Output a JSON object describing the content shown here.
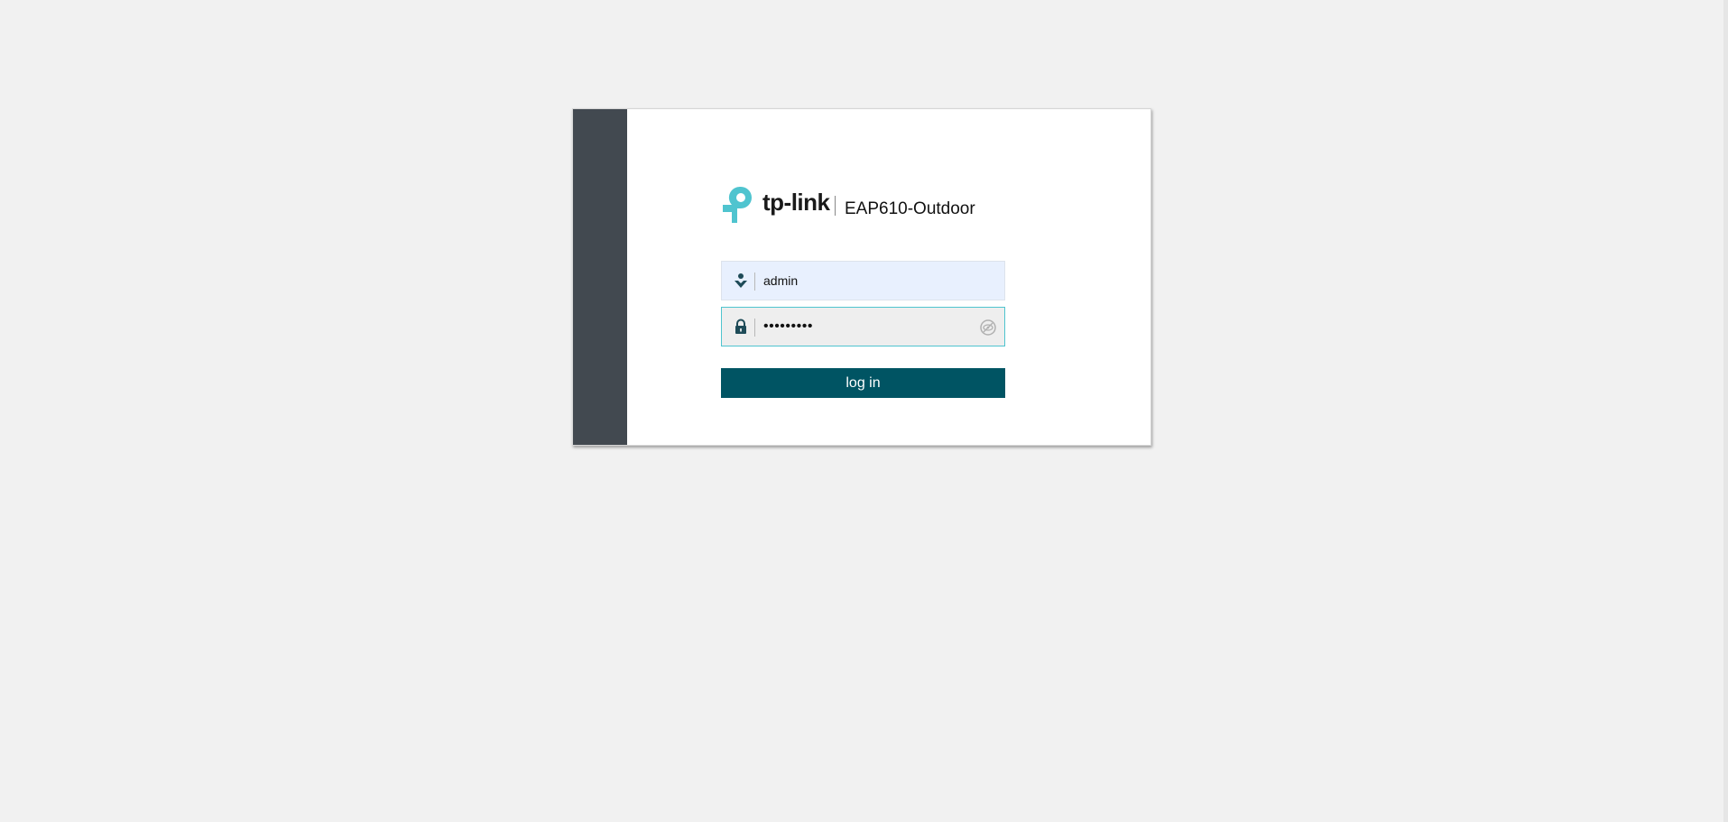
{
  "brand": {
    "name": "tp-link",
    "model": "EAP610-Outdoor"
  },
  "login": {
    "username_value": "admin",
    "password_value": "•••••••••",
    "login_label": "log in"
  },
  "icons": {
    "logo": "tp-link-logo-icon",
    "username": "user-icon",
    "password": "lock-icon",
    "toggle": "eye-off-icon"
  },
  "colors": {
    "background": "#f1f1f1",
    "side_panel": "#424950",
    "accent": "#4fc4cf",
    "button": "#005463",
    "username_field": "#e8f0fe"
  }
}
